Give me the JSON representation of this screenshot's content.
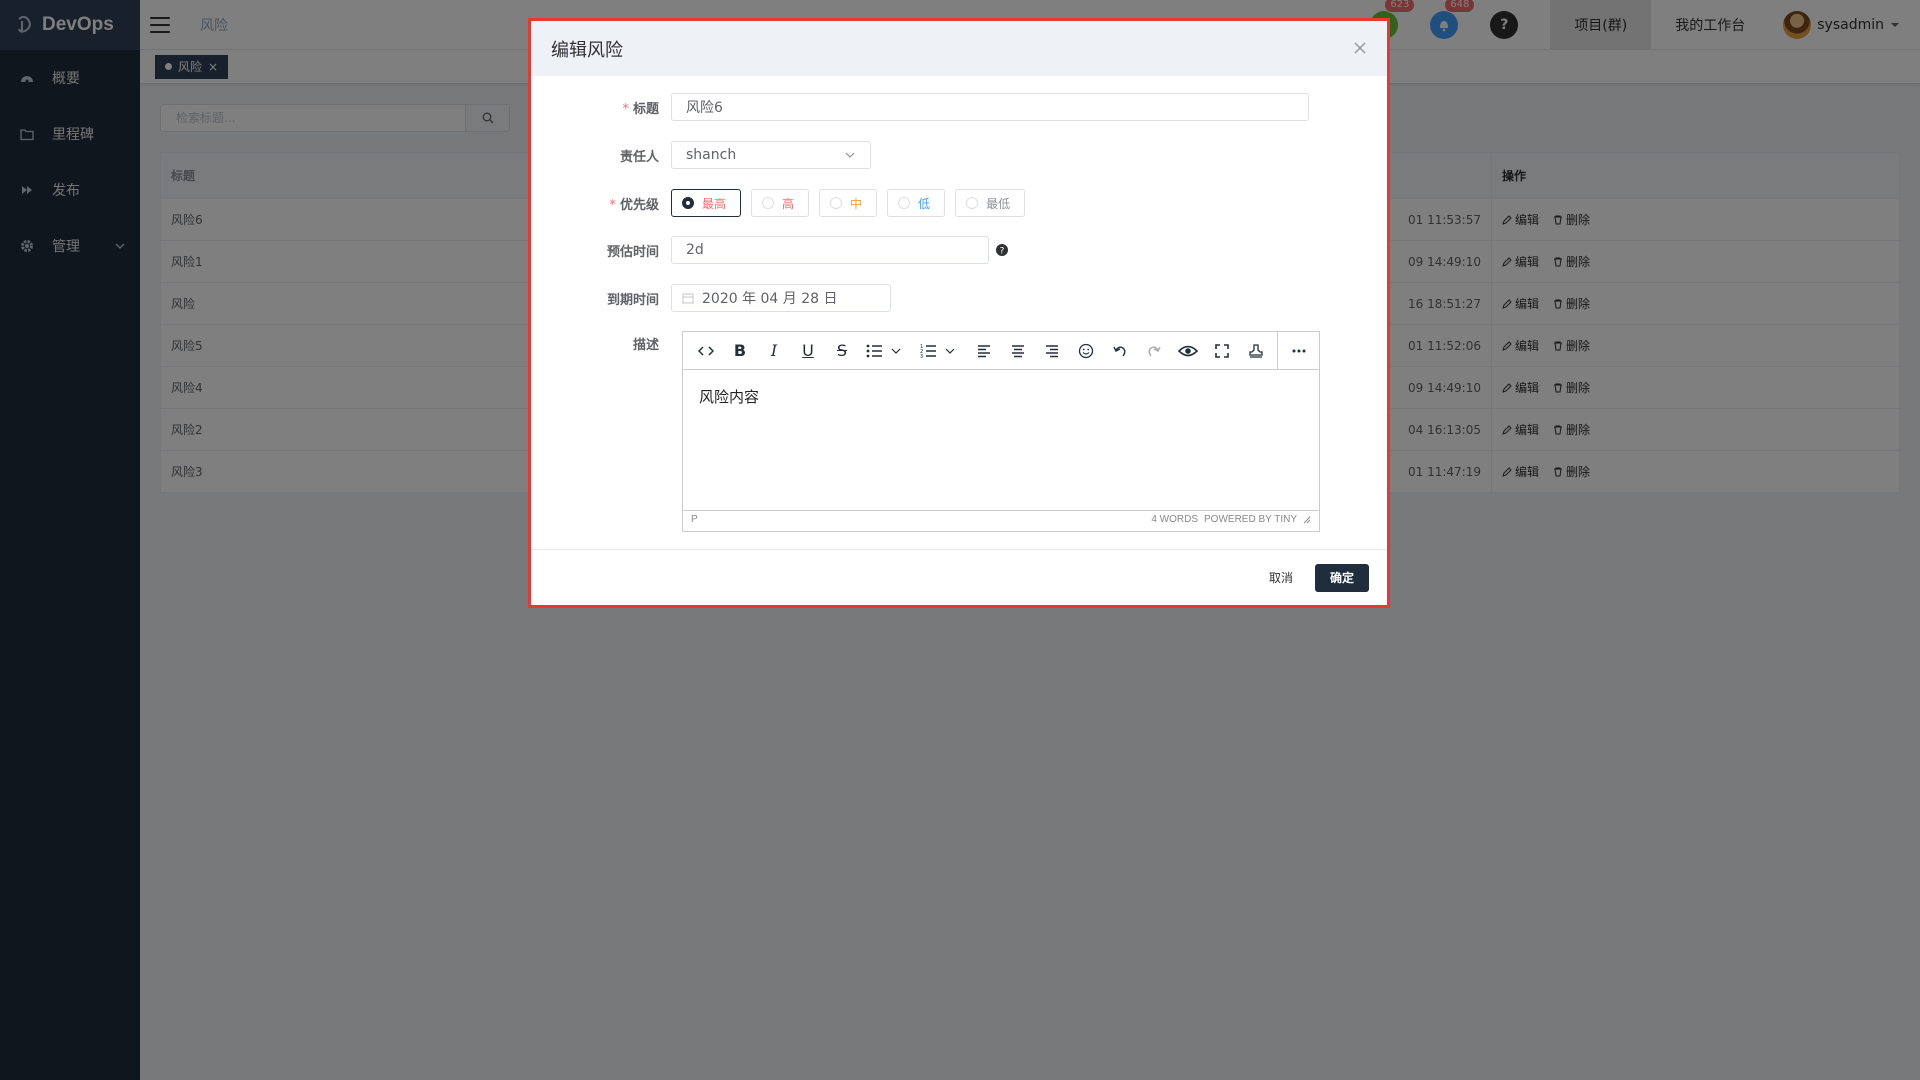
{
  "app": {
    "brand": "DevOps",
    "breadcrumb": "风险"
  },
  "sidebar": {
    "items": [
      {
        "label": "概要",
        "icon": "dashboard-icon"
      },
      {
        "label": "里程碑",
        "icon": "folder-icon"
      },
      {
        "label": "发布",
        "icon": "forward-icon"
      },
      {
        "label": "管理",
        "icon": "gear-icon"
      }
    ]
  },
  "header": {
    "badge_docs": "623",
    "badge_notify": "648",
    "help": "?",
    "menu_project": "项目(群)",
    "menu_workbench": "我的工作台",
    "user": "sysadmin",
    "colors": {
      "docs": "#67c23a",
      "notify": "#409eff",
      "help": "#303133"
    }
  },
  "tags": {
    "active": "风险",
    "close": "×"
  },
  "search": {
    "placeholder": "检索标题..."
  },
  "table": {
    "headers": {
      "title": "标题",
      "ops": "操作"
    },
    "edit_label": "编辑",
    "delete_label": "删除",
    "rows": [
      {
        "title": "风险6",
        "time": "01 11:53:57"
      },
      {
        "title": "风险1",
        "time": "09 14:49:10"
      },
      {
        "title": "风险",
        "time": "16 18:51:27"
      },
      {
        "title": "风险5",
        "time": "01 11:52:06"
      },
      {
        "title": "风险4",
        "time": "09 14:49:10"
      },
      {
        "title": "风险2",
        "time": "04 16:13:05"
      },
      {
        "title": "风险3",
        "time": "01 11:47:19"
      }
    ]
  },
  "dialog": {
    "title": "编辑风险",
    "fields": {
      "title_label": "标题",
      "title_value": "风险6",
      "owner_label": "责任人",
      "owner_value": "shanch",
      "priority_label": "优先级",
      "priorities": [
        {
          "label": "最高",
          "color": "#f56c6c",
          "checked": true
        },
        {
          "label": "高",
          "color": "#f56c6c",
          "checked": false
        },
        {
          "label": "中",
          "color": "#e6a23c",
          "checked": false
        },
        {
          "label": "低",
          "color": "#409eff",
          "checked": false
        },
        {
          "label": "最低",
          "color": "#909399",
          "checked": false
        }
      ],
      "estimate_label": "预估时间",
      "estimate_value": "2d",
      "due_label": "到期时间",
      "due_value": "2020 年 04 月 28 日",
      "desc_label": "描述"
    },
    "editor": {
      "content": "风险内容",
      "status_path": "P",
      "status_words": "4 WORDS",
      "status_powered": "POWERED BY TINY",
      "toolbar": [
        "code-icon",
        "bold-icon",
        "italic-icon",
        "underline-icon",
        "strikethrough-icon",
        "bullet-list-icon",
        "numbered-list-icon",
        "align-left-icon",
        "align-center-icon",
        "align-right-icon",
        "emoji-icon",
        "undo-icon",
        "redo-icon",
        "preview-icon",
        "fullscreen-icon",
        "stamp-icon",
        "more-icon"
      ]
    },
    "cancel": "取消",
    "confirm": "确定"
  }
}
